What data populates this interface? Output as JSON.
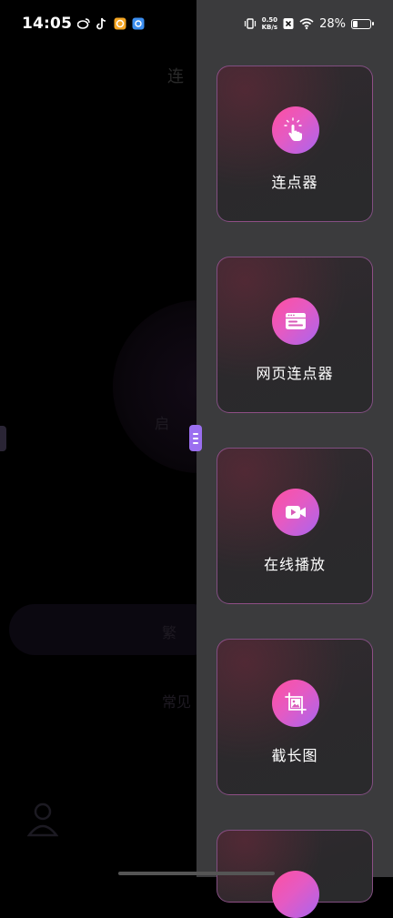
{
  "status_bar": {
    "time": "14:05",
    "net_speed_value": "0.50",
    "net_speed_unit": "KB/s",
    "battery_percent": "28%",
    "battery_level": 0.28,
    "icons": [
      "weibo-icon",
      "tiktok-icon",
      "app-icon-orange",
      "app-icon-blue",
      "vibrate-icon",
      "no-sim-icon",
      "wifi-icon",
      "battery-icon"
    ]
  },
  "background_app": {
    "title": "连",
    "circle_text": "启",
    "pill_text": "繁",
    "faq_text": "常见"
  },
  "drawer": {
    "items": [
      {
        "label": "连点器",
        "icon": "tap-icon"
      },
      {
        "label": "网页连点器",
        "icon": "web-page-icon"
      },
      {
        "label": "在线播放",
        "icon": "video-camera-icon"
      },
      {
        "label": "截长图",
        "icon": "screenshot-image-icon"
      },
      {
        "label": "",
        "icon": "more-icon"
      }
    ]
  },
  "colors": {
    "accent_gradient_start": "#ff4fa0",
    "accent_gradient_end": "#a865f0",
    "panel_bg": "#3b3b3d",
    "handle": "#9b6ff0"
  }
}
